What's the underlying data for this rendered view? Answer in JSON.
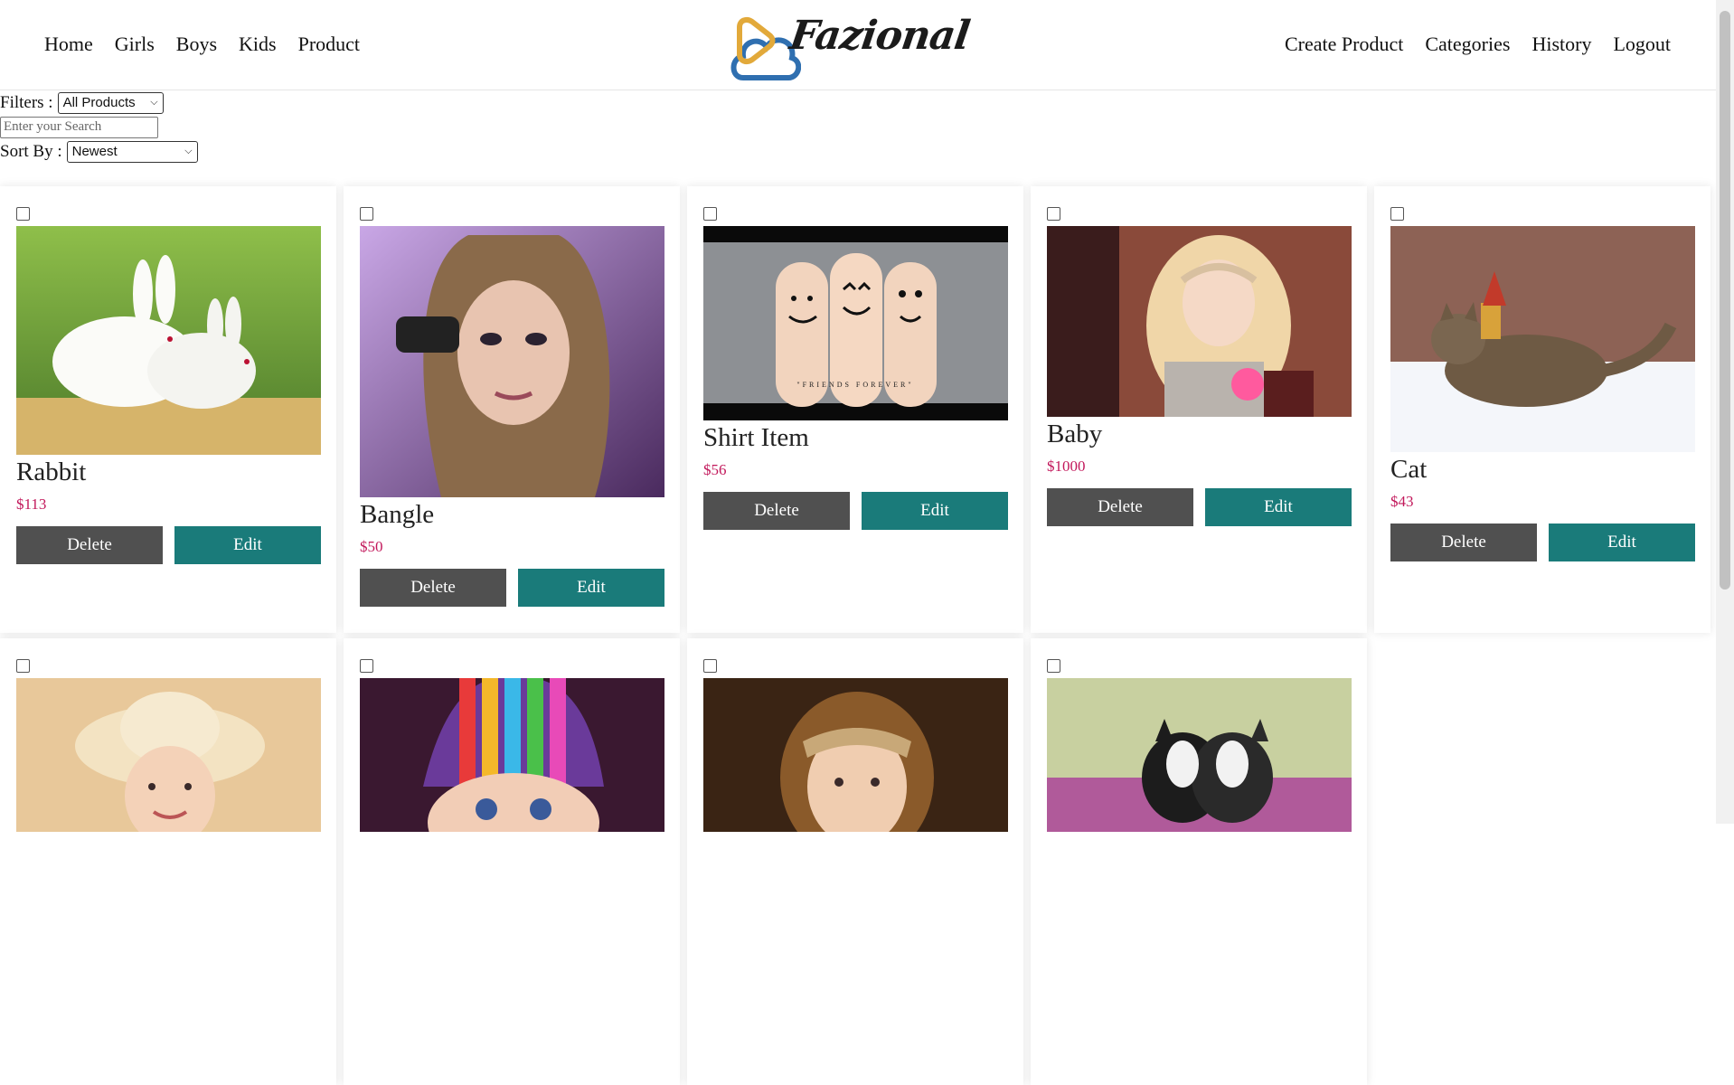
{
  "nav": {
    "left": [
      "Home",
      "Girls",
      "Boys",
      "Kids",
      "Product"
    ],
    "right": [
      "Create Product",
      "Categories",
      "History",
      "Logout"
    ]
  },
  "logo": {
    "text": "Fazional"
  },
  "filters": {
    "filters_label": "Filters :",
    "filter_value": "All Products",
    "search_placeholder": "Enter your Search",
    "sort_label": "Sort By :",
    "sort_value": "Newest"
  },
  "buttons": {
    "delete": "Delete",
    "edit": "Edit"
  },
  "products": [
    {
      "title": "Rabbit",
      "price": "$113",
      "image": "rabbit-photo"
    },
    {
      "title": "Bangle",
      "price": "$50",
      "image": "woman-portrait-photo"
    },
    {
      "title": "Shirt Item",
      "price": "$56",
      "image": "fingers-friends-forever-photo"
    },
    {
      "title": "Baby",
      "price": "$1000",
      "image": "girl-with-rose-photo"
    },
    {
      "title": "Cat",
      "price": "$43",
      "image": "cat-in-snow-painting"
    },
    {
      "title": "",
      "price": "",
      "image": "girl-in-hat-photo"
    },
    {
      "title": "",
      "price": "",
      "image": "baby-knit-hat-photo"
    },
    {
      "title": "",
      "price": "",
      "image": "girl-headband-photo"
    },
    {
      "title": "",
      "price": "",
      "image": "dogs-in-flowers-photo"
    }
  ],
  "image_caption": "\"FRIENDS FOREVER\"",
  "colors": {
    "accent": "#1a7b7a",
    "delete": "#505050",
    "price": "#c2185b"
  }
}
